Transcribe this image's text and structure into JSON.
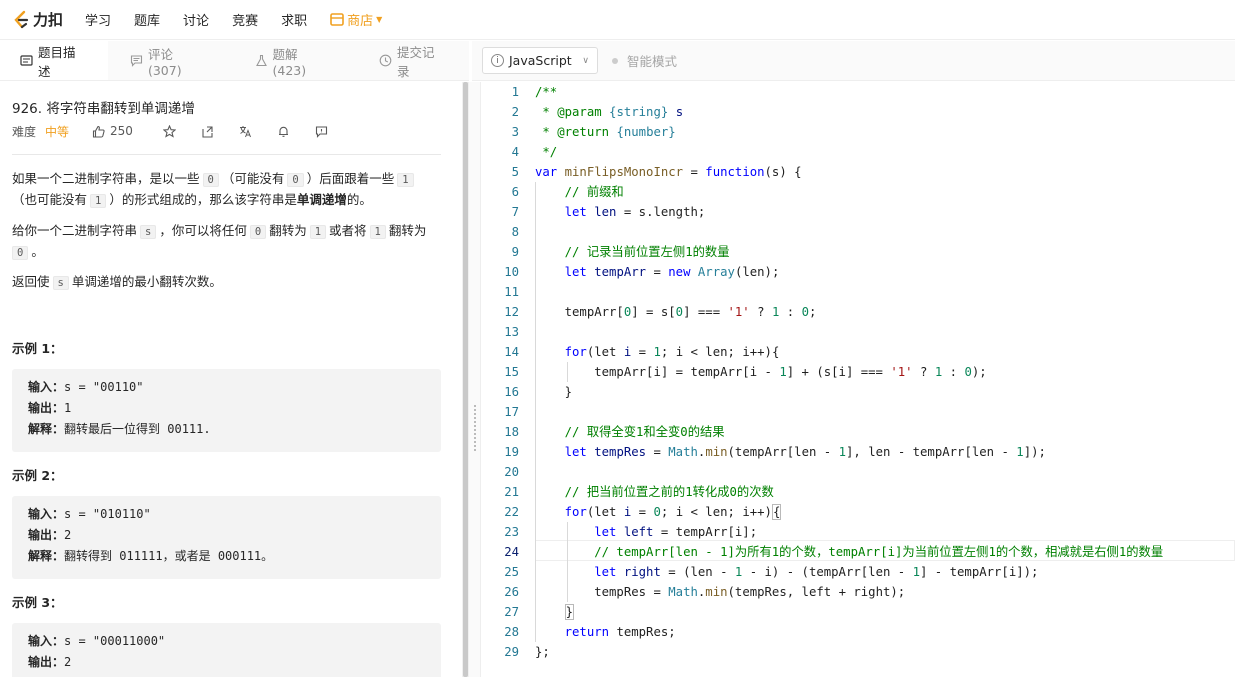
{
  "nav": {
    "logo_text": "力扣",
    "items": [
      "学习",
      "题库",
      "讨论",
      "竞赛",
      "求职"
    ],
    "shop_label": "商店"
  },
  "left_tabs": [
    {
      "label": "题目描述",
      "icon": "description-icon"
    },
    {
      "label": "评论 (307)",
      "icon": "comment-icon"
    },
    {
      "label": "题解 (423)",
      "icon": "flask-icon"
    },
    {
      "label": "提交记录",
      "icon": "clock-icon"
    }
  ],
  "editor_bar": {
    "language": "JavaScript",
    "smart_mode": "智能模式"
  },
  "problem": {
    "title": "926. 将字符串翻转到单调递增",
    "difficulty_label": "难度",
    "difficulty": "中等",
    "likes": "250",
    "p1_a": "如果一个二进制字符串，是以一些",
    "p1_c0": "0",
    "p1_b": "（可能没有",
    "p1_c1": "0",
    "p1_c": "）后面跟着一些",
    "p1_c2": "1",
    "p1_d": "（也可能没有",
    "p1_c3": "1",
    "p1_e": "）的形式组成的，那么该字符串是",
    "p1_bold": "单调递增",
    "p1_f": "的。",
    "p2_a": "给你一个二进制字符串",
    "p2_c0": "s",
    "p2_b": "，你可以将任何",
    "p2_c1": "0",
    "p2_c": "翻转为",
    "p2_c2": "1",
    "p2_d": "或者将",
    "p2_c3": "1",
    "p2_e": "翻转为",
    "p2_c4": "0",
    "p2_f": "。",
    "p3_a": "返回使",
    "p3_c0": "s",
    "p3_b": "单调递增的最小翻转次数。"
  },
  "examples": [
    {
      "title": "示例 1：",
      "input": "s = \"00110\"",
      "output": "1",
      "explain": "翻转最后一位得到 00111."
    },
    {
      "title": "示例 2：",
      "input": "s = \"010110\"",
      "output": "2",
      "explain": "翻转得到 011111，或者是 000111。"
    },
    {
      "title": "示例 3：",
      "input": "s = \"00011000\"",
      "output": "2"
    }
  ],
  "example_labels": {
    "input": "输入：",
    "output": "输出：",
    "explain": "解释："
  },
  "code": {
    "line_numbers": [
      "1",
      "2",
      "3",
      "4",
      "5",
      "6",
      "7",
      "8",
      "9",
      "10",
      "11",
      "12",
      "13",
      "14",
      "15",
      "16",
      "17",
      "18",
      "19",
      "20",
      "21",
      "22",
      "23",
      "24",
      "25",
      "26",
      "27",
      "28",
      "29"
    ],
    "l1": "/**",
    "l2_a": " * ",
    "l2_b": "@param",
    "l2_c": " {string} ",
    "l2_d": "s",
    "l3_a": " * ",
    "l3_b": "@return",
    "l3_c": " {number}",
    "l4": " */",
    "l5_a": "var",
    "l5_b": " minFlipsMonoIncr ",
    "l5_c": "= ",
    "l5_d": "function",
    "l5_e": "(s) {",
    "l6": "    // 前缀和",
    "l7_a": "    let ",
    "l7_b": "len ",
    "l7_c": "= s.length;",
    "l9": "    // 记录当前位置左侧1的数量",
    "l10_a": "    let ",
    "l10_b": "tempArr ",
    "l10_c": "= ",
    "l10_d": "new ",
    "l10_e": "Array",
    "l10_f": "(len);",
    "l12_a": "    tempArr[",
    "l12_b": "0",
    "l12_c": "] = s[",
    "l12_d": "0",
    "l12_e": "] === ",
    "l12_f": "'1'",
    "l12_g": " ? ",
    "l12_h": "1",
    "l12_i": " : ",
    "l12_j": "0",
    "l12_k": ";",
    "l14_a": "    for",
    "l14_b": "(let ",
    "l14_c": "i ",
    "l14_d": "= ",
    "l14_e": "1",
    "l14_f": "; i < len; i++){",
    "l15_a": "        tempArr[i] = tempArr[i - ",
    "l15_b": "1",
    "l15_c": "] + (s[i] === ",
    "l15_d": "'1'",
    "l15_e": " ? ",
    "l15_f": "1",
    "l15_g": " : ",
    "l15_h": "0",
    "l15_i": ");",
    "l16": "    }",
    "l18": "    // 取得全变1和全变0的结果",
    "l19_a": "    let ",
    "l19_b": "tempRes ",
    "l19_c": "= ",
    "l19_d": "Math",
    "l19_e": ".",
    "l19_f": "min",
    "l19_g": "(tempArr[len - ",
    "l19_h": "1",
    "l19_i": "], len - tempArr[len - ",
    "l19_j": "1",
    "l19_k": "]);",
    "l21": "    // 把当前位置之前的1转化成0的次数",
    "l22_a": "    for",
    "l22_b": "(let ",
    "l22_c": "i ",
    "l22_d": "= ",
    "l22_e": "0",
    "l22_f": "; i < len; i++)",
    "l22_g": "{",
    "l23_a": "        let ",
    "l23_b": "left ",
    "l23_c": "= tempArr[i];",
    "l24": "        // tempArr[len - 1]为所有1的个数，tempArr[i]为当前位置左侧1的个数，相减就是右侧1的数量",
    "l25_a": "        let ",
    "l25_b": "right ",
    "l25_c": "= (len - ",
    "l25_d": "1",
    "l25_e": " - i) - (tempArr[len - ",
    "l25_f": "1",
    "l25_g": "] - tempArr[i]);",
    "l26_a": "        tempRes = ",
    "l26_b": "Math",
    "l26_c": ".",
    "l26_d": "min",
    "l26_e": "(tempRes, left + right);",
    "l27_a": "    ",
    "l27_b": "}",
    "l28_a": "    return ",
    "l28_b": "tempRes;",
    "l29": "};"
  }
}
